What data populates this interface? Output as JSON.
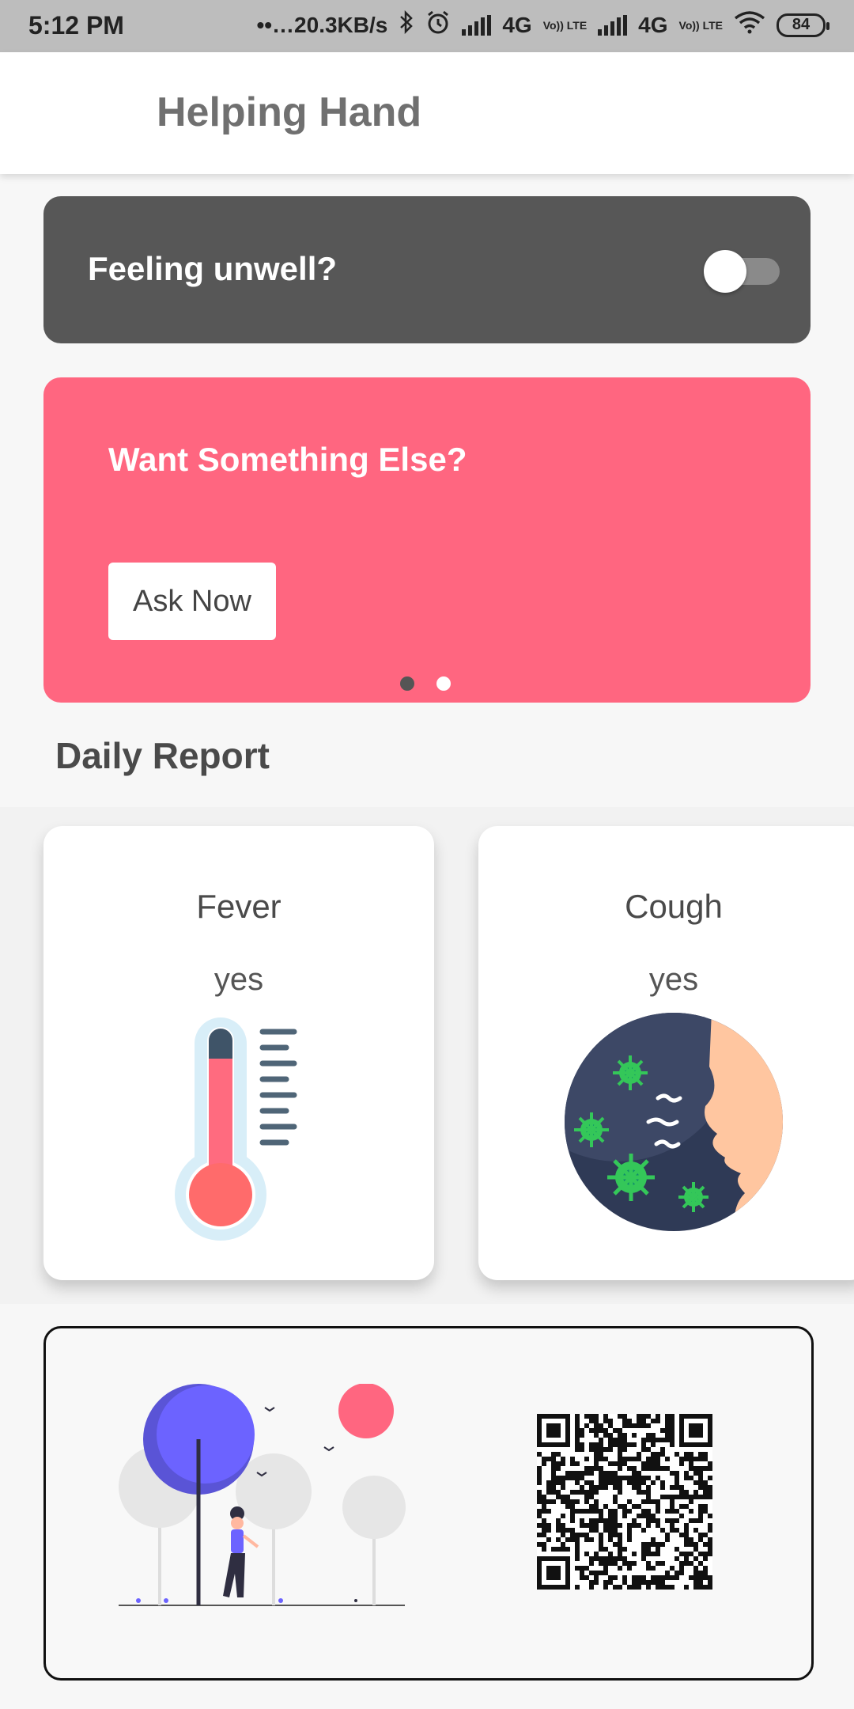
{
  "status_bar": {
    "time": "5:12 PM",
    "speed": "••…20.3KB/s",
    "network1": "4G",
    "network2": "4G",
    "lte_label": "Vo)) LTE",
    "battery": "84"
  },
  "app_bar": {
    "title": "Helping Hand"
  },
  "unwell": {
    "label": "Feeling unwell?",
    "toggle_on": false
  },
  "banner": {
    "title": "Want Something Else?",
    "button_label": "Ask Now",
    "page_count": 2,
    "active_page": 0
  },
  "daily_report": {
    "title": "Daily Report",
    "cards": [
      {
        "title": "Fever",
        "value": "yes",
        "icon": "thermometer-icon"
      },
      {
        "title": "Cough",
        "value": "yes",
        "icon": "cough-icon"
      }
    ]
  },
  "colors": {
    "accent_pink": "#ff6680",
    "dark_card": "#575757",
    "illus_purple": "#6c63ff"
  }
}
